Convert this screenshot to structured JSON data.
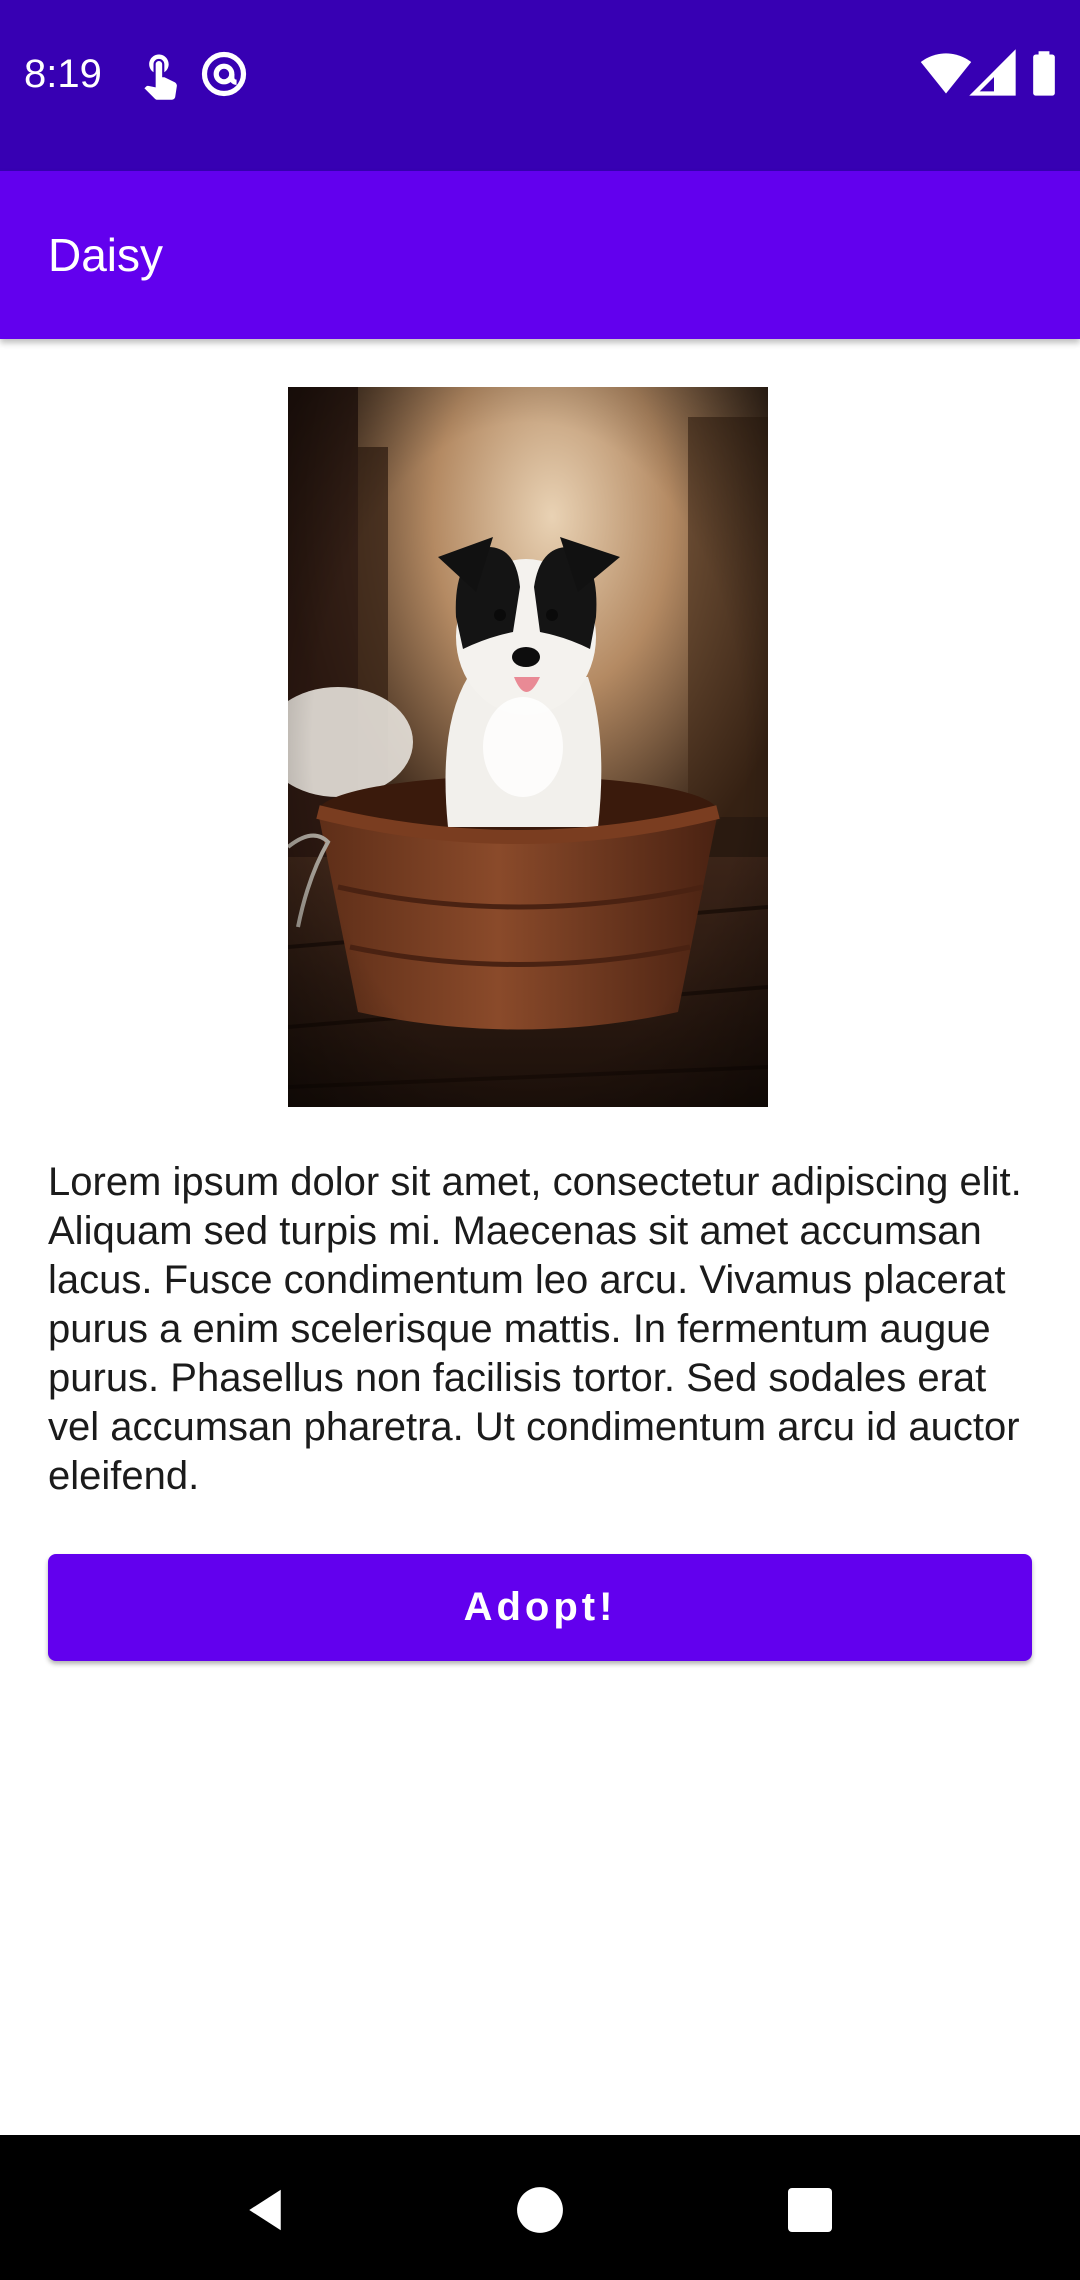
{
  "status_bar": {
    "time": "8:19",
    "left_icons": [
      "touch-app-icon",
      "at-sign-icon"
    ],
    "right_icons": [
      "wifi-icon",
      "cell-signal-icon",
      "battery-icon"
    ],
    "background": "#3700b3"
  },
  "app_bar": {
    "title": "Daisy",
    "background": "#6200ee"
  },
  "content": {
    "photo_subject": "puppy-photo",
    "description": "Lorem ipsum dolor sit amet, consectetur adipiscing elit. Aliquam sed turpis mi. Maecenas sit amet accumsan lacus. Fusce condimentum leo arcu. Vivamus placerat purus a enim scelerisque mattis. In fermentum augue purus. Phasellus non facilisis tortor. Sed sodales erat vel accumsan pharetra. Ut condimentum arcu id auctor eleifend.",
    "adopt_button_label": "Adopt!",
    "accent": "#6200ee"
  },
  "nav_bar": {
    "icons": [
      "back-icon",
      "home-icon",
      "recents-icon"
    ]
  }
}
